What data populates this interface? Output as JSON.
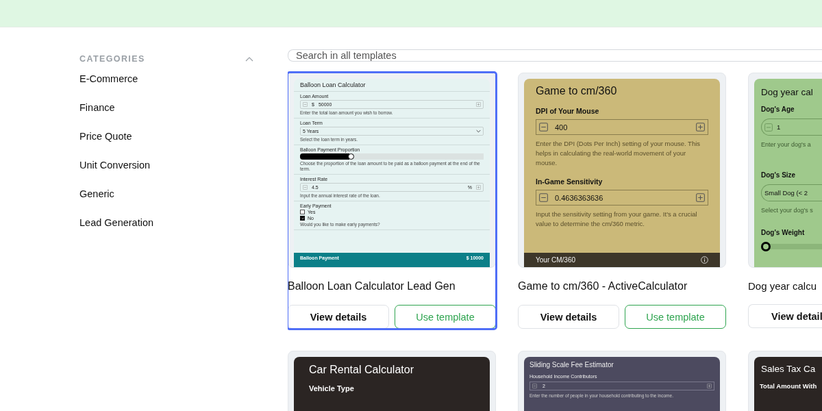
{
  "sidebar": {
    "heading": "CATEGORIES",
    "expanded": true,
    "items": [
      {
        "label": "E-Commerce",
        "selected": false
      },
      {
        "label": "Finance",
        "selected": false
      },
      {
        "label": "Price Quote",
        "selected": false
      },
      {
        "label": "Unit Conversion",
        "selected": false
      },
      {
        "label": "Generic",
        "selected": false
      },
      {
        "label": "Lead Generation",
        "selected": false
      }
    ]
  },
  "search": {
    "placeholder": "Search in all templates"
  },
  "rows": [
    {
      "cards": [
        {
          "selected": true,
          "title": "Balloon Loan Calculator Lead Gen",
          "buttons": [
            "View details",
            "Use template"
          ],
          "preview": {
            "kind": "teal",
            "title": "Balloon Loan Calculator",
            "fields": [
              {
                "kind": "number",
                "label": "Loan Amount",
                "prefix": "$",
                "value": "50000",
                "help": "Enter the total loan amount you wish to borrow."
              },
              {
                "kind": "select",
                "label": "Loan Term",
                "value": "5 Years",
                "help": "Select the loan term in years."
              },
              {
                "kind": "slider",
                "label": "Balloon Payment Proportion",
                "level": 0.27,
                "help": "Choose the proportion of the loan amount to be paid as a balloon payment at the end of the term."
              },
              {
                "kind": "number",
                "label": "Interest Rate",
                "value": "4.5",
                "suffix": "%",
                "help": "Input the annual interest rate of the loan."
              },
              {
                "kind": "checks",
                "label": "Early Payment",
                "options": [
                  {
                    "label": "Yes",
                    "checked": false
                  },
                  {
                    "label": "No",
                    "checked": true
                  }
                ],
                "help": "Would you like to make early payments?"
              }
            ],
            "result": {
              "label": "Balloon Payment",
              "value": "$ 10000"
            }
          }
        },
        {
          "selected": false,
          "title": "Game to cm/360 - ActiveCalculator",
          "buttons": [
            "View details",
            "Use template"
          ],
          "preview": {
            "kind": "gold",
            "title": "Game to cm/360",
            "fields": [
              {
                "kind": "number",
                "label": "DPI of Your Mouse",
                "value": "400",
                "help": "Enter the DPI (Dots Per Inch) setting of your mouse. This helps in calculating the real-world movement of your mouse."
              },
              {
                "kind": "number",
                "label": "In-Game Sensitivity",
                "value": "0.4636363636",
                "help": "Input the sensitivity setting from your game. It's a crucial value to determine the cm/360 metric."
              }
            ],
            "result": {
              "label": "Your CM/360",
              "info": true
            }
          }
        },
        {
          "selected": false,
          "title": "Dog year calcu",
          "buttons": [
            "View detail"
          ],
          "preview": {
            "kind": "green",
            "title": "Dog year cal",
            "fields": [
              {
                "kind": "number",
                "label": "Dog's Age",
                "value": "1",
                "help": "Enter your dog's a"
              },
              {
                "kind": "select",
                "label": "Dog's Size",
                "value": "Small Dog (< 2",
                "help": "Select your dog's s"
              },
              {
                "kind": "slider",
                "label": "Dog's Weight",
                "level": 0
              }
            ]
          }
        }
      ]
    },
    {
      "cards": [
        {
          "selected": false,
          "preview": {
            "kind": "dark",
            "title": "Car Rental Calculator",
            "fields": [
              {
                "label": "Vehicle Type"
              }
            ]
          }
        },
        {
          "selected": false,
          "preview": {
            "kind": "purple",
            "title": "Sliding Scale Fee Estimator",
            "fields": [
              {
                "kind": "number",
                "label": "Household Income Contributors",
                "value": "2",
                "help": "Enter the number of people in your household contributing to the income."
              }
            ]
          }
        },
        {
          "selected": false,
          "preview": {
            "kind": "dark",
            "title": "Sales Tax Ca",
            "fields": [
              {
                "label": "Total Amount With"
              }
            ]
          }
        }
      ]
    }
  ]
}
